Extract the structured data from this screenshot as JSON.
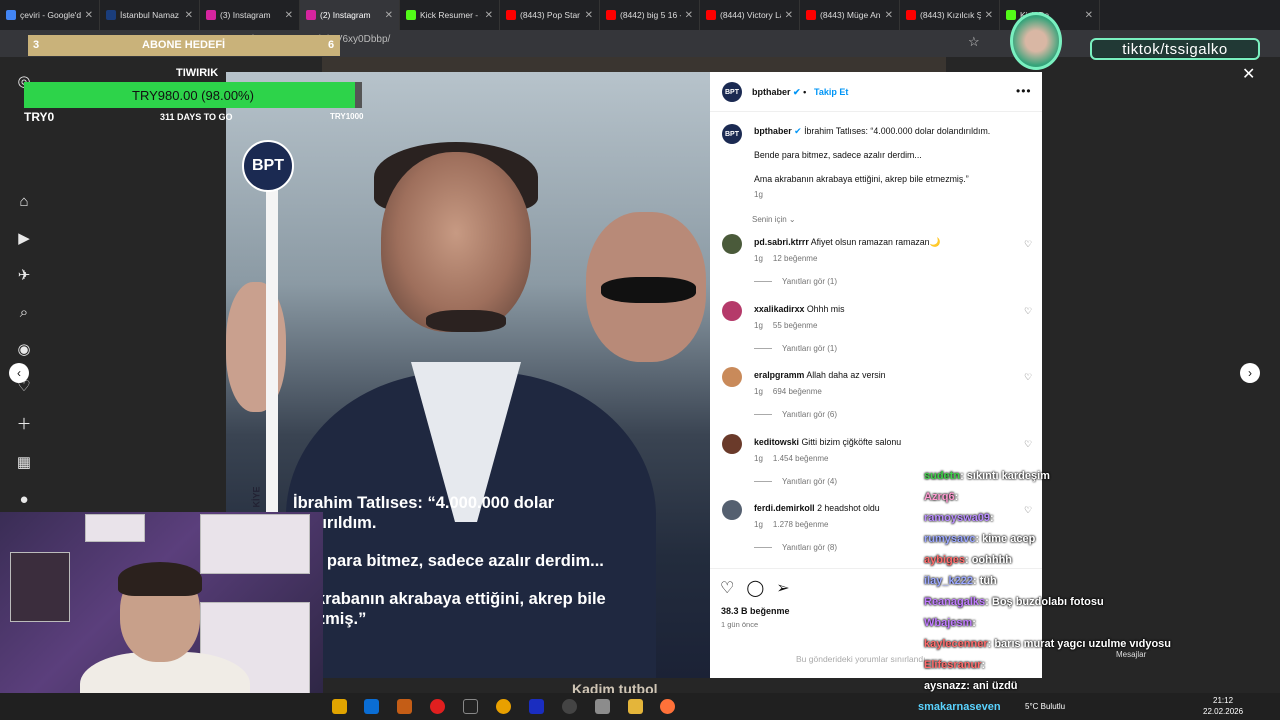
{
  "browser": {
    "tabs": [
      {
        "label": "çeviri - Google'da",
        "color": "#4285f4",
        "active": false
      },
      {
        "label": "İstanbul Namaz V",
        "color": "#1a3d7c",
        "active": false
      },
      {
        "label": "(3) Instagram",
        "color": "#d6249f",
        "active": false
      },
      {
        "label": "(2) Instagram",
        "color": "#d6249f",
        "active": true
      },
      {
        "label": "Kick Resumer - C",
        "color": "#53fc18",
        "active": false
      },
      {
        "label": "(8443) Pop Star A",
        "color": "#ff0000",
        "active": false
      },
      {
        "label": "(8442) big 5 16 -",
        "color": "#ff0000",
        "active": false
      },
      {
        "label": "(8444) Victory La",
        "color": "#ff0000",
        "active": false
      },
      {
        "label": "(8443) Müge Anlı",
        "color": "#ff0000",
        "active": false
      },
      {
        "label": "(8443) Kızılcık Şer",
        "color": "#ff0000",
        "active": false
      },
      {
        "label": "Kick Da",
        "color": "#53fc18",
        "active": false
      }
    ],
    "url": "www.instagram.com/p/DV6xy0Dbbp/"
  },
  "overlay": {
    "goal_count_left": "3",
    "goal_title": "ABONE HEDEFİ",
    "goal_count_right": "6",
    "tip_title": "TIWIRIK",
    "progress_label": "TRY980.00 (98.00%)",
    "progress_fraction": 0.98,
    "progress_min": "TRY0",
    "progress_days": "311 DAYS TO GO",
    "progress_max": "TRY1000",
    "tiktok": "tiktok/tssigalko"
  },
  "post": {
    "image_caption_lines": [
      "İbrahim Tatlıses: “4.000.000 dolar",
      "andırıldım.",
      "nde para bitmez, sadece azalır derdim...",
      "a akrabanın akrabaya ettiğini, akrep bile",
      "mezmiş.”"
    ],
    "logo_text": "BPT",
    "vertical_text": "KİYE",
    "account": "bpthaber",
    "follow_label": "Takip Et",
    "caption_line1": "İbrahim Tatlıses: “4.000.000 dolar dolandırıldım.",
    "caption_line2": "Bende para bitmez, sadece azalır derdim...",
    "caption_line3": "Ama akrabanın akrabaya ettiğini, akrep bile etmezmiş.”",
    "caption_age": "1g",
    "for_you": "Senin için",
    "comments": [
      {
        "user": "pd.sabri.ktrrr",
        "text": "Afiyet olsun ramazan ramazan🌙",
        "age": "1g",
        "likes": "12 beğenme",
        "replies": "Yanıtları gör (1)"
      },
      {
        "user": "xxalikadirxx",
        "text": "Ohhh mis",
        "age": "1g",
        "likes": "55 beğenme",
        "replies": "Yanıtları gör (1)"
      },
      {
        "user": "eralpgramm",
        "text": "Allah daha az versin",
        "age": "1g",
        "likes": "694 beğenme",
        "replies": "Yanıtları gör (6)"
      },
      {
        "user": "keditowski",
        "text": "Gitti bizim çiğköfte salonu",
        "age": "1g",
        "likes": "1.454 beğenme",
        "replies": "Yanıtları gör (4)"
      },
      {
        "user": "ferdi.demirkoll",
        "text": "2 headshot oldu",
        "age": "1g",
        "likes": "1.278 beğenme",
        "replies": "Yanıtları gör (8)"
      }
    ],
    "total_likes": "38.3 B beğenme",
    "posted_ago": "1 gün önce",
    "comments_disabled": "Bu gönderideki yorumlar sınırlandı"
  },
  "chat": [
    {
      "user": "sudetn",
      "msg": ": sıkıntı kardeşim",
      "color": "#3fd14a"
    },
    {
      "user": "Azrq6",
      "msg": ":",
      "color": "#ff9ad0"
    },
    {
      "user": "ramoyswa09",
      "msg": ":",
      "color": "#b98cff"
    },
    {
      "user": "rumysavc",
      "msg": ": kime acep",
      "color": "#9aa7ff"
    },
    {
      "user": "aybiges",
      "msg": ": oohhhh",
      "color": "#ff6b6b"
    },
    {
      "user": "ilay_k222",
      "msg": ": tüh",
      "color": "#9aa7ff"
    },
    {
      "user": "Reanagalks",
      "msg": ": Boş buzdolabı fotosu",
      "color": "#c07bff"
    },
    {
      "user": "Wbajesm",
      "msg": ":",
      "color": "#c07bff"
    },
    {
      "user": "kaylecenner",
      "msg": ": barıs murat yagcı uzulme vıdyosu",
      "color": "#ff6b6b"
    },
    {
      "user": "Elifesranur",
      "msg": ":",
      "color": "#ff6b6b"
    },
    {
      "user": "aysnazz",
      "msg": ": ani üzdü",
      "color": "#ffffff"
    }
  ],
  "bottom_text": "Kadim tutbol",
  "taskbar": {
    "stream_user": "smakarnaseven",
    "weather": "5°C Bulutlu",
    "time": "21:12",
    "date": "22.02.2026",
    "messages": "Mesajlar"
  }
}
